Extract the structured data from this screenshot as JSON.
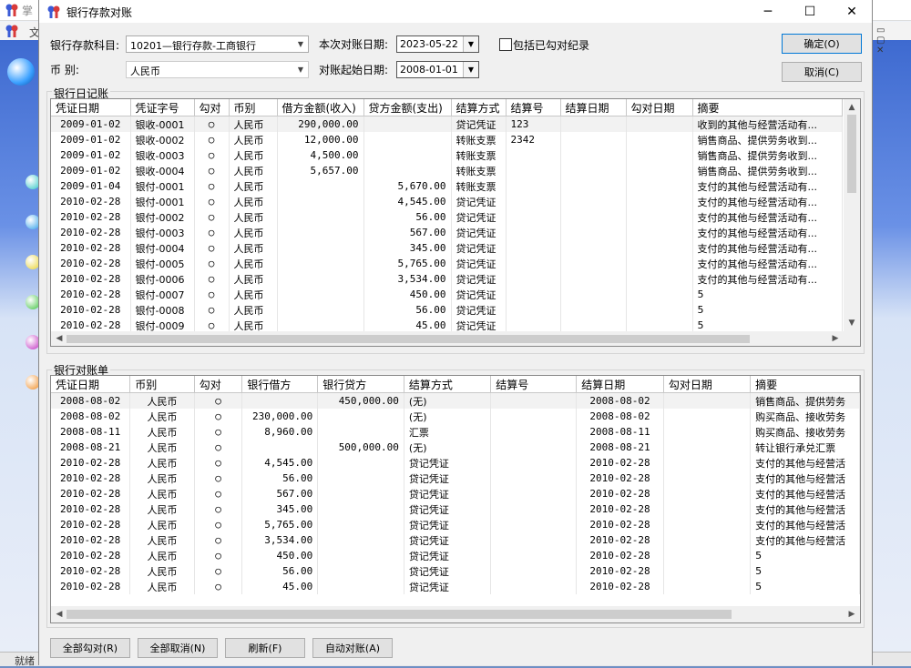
{
  "background": {
    "title": "掌",
    "menu": "文",
    "status": "就绪"
  },
  "dialog": {
    "title": "银行存款对账",
    "window_buttons": {
      "minimize": "─",
      "maximize": "☐",
      "close": "✕"
    }
  },
  "form": {
    "subject_label": "银行存款科目:",
    "subject_value": "10201—银行存款-工商银行",
    "currency_label": "币          别:",
    "currency_value": "人民币",
    "recon_date_label": "本次对账日期:",
    "recon_date_value": "2023-05-22",
    "start_date_label": "对账起始日期:",
    "start_date_value": "2008-01-01",
    "include_checked_label": "包括已勾对纪录",
    "ok_button": "确定(O)",
    "cancel_button": "取消(C)"
  },
  "journal": {
    "group_title": "银行日记账",
    "columns": [
      "凭证日期",
      "凭证字号",
      "勾对",
      "币别",
      "借方金额(收入)",
      "贷方金额(支出)",
      "结算方式",
      "结算号",
      "结算日期",
      "勾对日期",
      "摘要"
    ],
    "rows": [
      [
        "2009-01-02",
        "银收-0001",
        "○",
        "人民币",
        "290,000.00",
        "",
        "贷记凭证",
        "123",
        "",
        "",
        "收到的其他与经营活动有..."
      ],
      [
        "2009-01-02",
        "银收-0002",
        "○",
        "人民币",
        "12,000.00",
        "",
        "转账支票",
        "2342",
        "",
        "",
        "销售商品、提供劳务收到..."
      ],
      [
        "2009-01-02",
        "银收-0003",
        "○",
        "人民币",
        "4,500.00",
        "",
        "转账支票",
        "",
        "",
        "",
        "销售商品、提供劳务收到..."
      ],
      [
        "2009-01-02",
        "银收-0004",
        "○",
        "人民币",
        "5,657.00",
        "",
        "转账支票",
        "",
        "",
        "",
        "销售商品、提供劳务收到..."
      ],
      [
        "2009-01-04",
        "银付-0001",
        "○",
        "人民币",
        "",
        "5,670.00",
        "转账支票",
        "",
        "",
        "",
        "支付的其他与经营活动有..."
      ],
      [
        "2010-02-28",
        "银付-0001",
        "○",
        "人民币",
        "",
        "4,545.00",
        "贷记凭证",
        "",
        "",
        "",
        "支付的其他与经营活动有..."
      ],
      [
        "2010-02-28",
        "银付-0002",
        "○",
        "人民币",
        "",
        "56.00",
        "贷记凭证",
        "",
        "",
        "",
        "支付的其他与经营活动有..."
      ],
      [
        "2010-02-28",
        "银付-0003",
        "○",
        "人民币",
        "",
        "567.00",
        "贷记凭证",
        "",
        "",
        "",
        "支付的其他与经营活动有..."
      ],
      [
        "2010-02-28",
        "银付-0004",
        "○",
        "人民币",
        "",
        "345.00",
        "贷记凭证",
        "",
        "",
        "",
        "支付的其他与经营活动有..."
      ],
      [
        "2010-02-28",
        "银付-0005",
        "○",
        "人民币",
        "",
        "5,765.00",
        "贷记凭证",
        "",
        "",
        "",
        "支付的其他与经营活动有..."
      ],
      [
        "2010-02-28",
        "银付-0006",
        "○",
        "人民币",
        "",
        "3,534.00",
        "贷记凭证",
        "",
        "",
        "",
        "支付的其他与经营活动有..."
      ],
      [
        "2010-02-28",
        "银付-0007",
        "○",
        "人民币",
        "",
        "450.00",
        "贷记凭证",
        "",
        "",
        "",
        "5"
      ],
      [
        "2010-02-28",
        "银付-0008",
        "○",
        "人民币",
        "",
        "56.00",
        "贷记凭证",
        "",
        "",
        "",
        "5"
      ],
      [
        "2010-02-28",
        "银付-0009",
        "○",
        "人民币",
        "",
        "45.00",
        "贷记凭证",
        "",
        "",
        "",
        "5"
      ]
    ]
  },
  "statement": {
    "group_title": "银行对账单",
    "columns": [
      "凭证日期",
      "币别",
      "勾对",
      "银行借方",
      "银行贷方",
      "结算方式",
      "结算号",
      "结算日期",
      "勾对日期",
      "摘要"
    ],
    "rows": [
      [
        "2008-08-02",
        "人民币",
        "○",
        "",
        "450,000.00",
        "(无)",
        "",
        "2008-08-02",
        "",
        "销售商品、提供劳务"
      ],
      [
        "2008-08-02",
        "人民币",
        "○",
        "230,000.00",
        "",
        "(无)",
        "",
        "2008-08-02",
        "",
        "购买商品、接收劳务"
      ],
      [
        "2008-08-11",
        "人民币",
        "○",
        "8,960.00",
        "",
        "汇票",
        "",
        "2008-08-11",
        "",
        "购买商品、接收劳务"
      ],
      [
        "2008-08-21",
        "人民币",
        "○",
        "",
        "500,000.00",
        "(无)",
        "",
        "2008-08-21",
        "",
        "转让银行承兑汇票"
      ],
      [
        "2010-02-28",
        "人民币",
        "○",
        "4,545.00",
        "",
        "贷记凭证",
        "",
        "2010-02-28",
        "",
        "支付的其他与经营活"
      ],
      [
        "2010-02-28",
        "人民币",
        "○",
        "56.00",
        "",
        "贷记凭证",
        "",
        "2010-02-28",
        "",
        "支付的其他与经营活"
      ],
      [
        "2010-02-28",
        "人民币",
        "○",
        "567.00",
        "",
        "贷记凭证",
        "",
        "2010-02-28",
        "",
        "支付的其他与经营活"
      ],
      [
        "2010-02-28",
        "人民币",
        "○",
        "345.00",
        "",
        "贷记凭证",
        "",
        "2010-02-28",
        "",
        "支付的其他与经营活"
      ],
      [
        "2010-02-28",
        "人民币",
        "○",
        "5,765.00",
        "",
        "贷记凭证",
        "",
        "2010-02-28",
        "",
        "支付的其他与经营活"
      ],
      [
        "2010-02-28",
        "人民币",
        "○",
        "3,534.00",
        "",
        "贷记凭证",
        "",
        "2010-02-28",
        "",
        "支付的其他与经营活"
      ],
      [
        "2010-02-28",
        "人民币",
        "○",
        "450.00",
        "",
        "贷记凭证",
        "",
        "2010-02-28",
        "",
        "5"
      ],
      [
        "2010-02-28",
        "人民币",
        "○",
        "56.00",
        "",
        "贷记凭证",
        "",
        "2010-02-28",
        "",
        "5"
      ],
      [
        "2010-02-28",
        "人民币",
        "○",
        "45.00",
        "",
        "贷记凭证",
        "",
        "2010-02-28",
        "",
        "5"
      ]
    ]
  },
  "buttons": {
    "check_all": "全部勾对(R)",
    "uncheck_all": "全部取消(N)",
    "refresh": "刷新(F)",
    "auto_recon": "自动对账(A)"
  },
  "colors": {
    "accent": "#0078d7",
    "dialog_bg": "#f0f0f0",
    "selected_row": "#f2f2f2"
  }
}
